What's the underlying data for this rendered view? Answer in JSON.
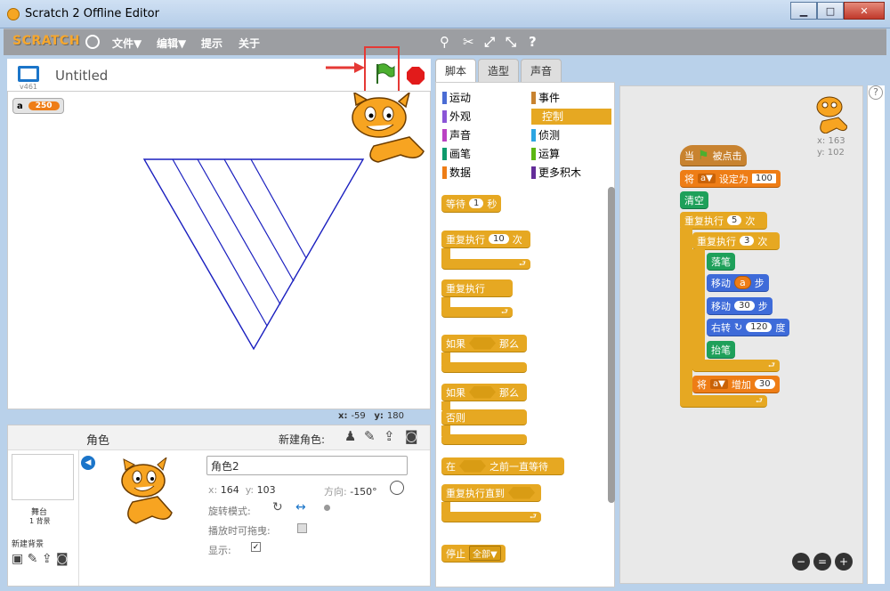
{
  "window": {
    "title": "Scratch 2 Offline Editor",
    "minimize": "▁",
    "maximize": "□",
    "close": "✕"
  },
  "menubar": {
    "logo": "SCRATCH",
    "items": [
      "文件▼",
      "编辑▼",
      "提示",
      "关于"
    ]
  },
  "stage": {
    "version": "v461",
    "project_title": "Untitled",
    "variable": {
      "name": "a",
      "value": "250"
    },
    "mouse": {
      "x_label": "x:",
      "x": "-59",
      "y_label": "y:",
      "y": "180"
    }
  },
  "sprites": {
    "header_title": "角色",
    "new_sprite_label": "新建角色:",
    "stage_label": "舞台",
    "stage_backdrops": "1 背景",
    "new_backdrop": "新建背景",
    "sprite_name": "角色2",
    "x_label": "x:",
    "x": "164",
    "y_label": "y:",
    "y": "103",
    "direction_label": "方向:",
    "direction": "-150°",
    "rotation_label": "旋转模式:",
    "drag_label": "播放时可拖曳:",
    "show_label": "显示:"
  },
  "tabs": [
    "脚本",
    "造型",
    "声音"
  ],
  "categories": [
    {
      "label": "运动",
      "color": "#4a6cd4"
    },
    {
      "label": "事件",
      "color": "#c88330"
    },
    {
      "label": "外观",
      "color": "#8a55d7"
    },
    {
      "label": "控制",
      "color": "#e6a822",
      "selected": true
    },
    {
      "label": "声音",
      "color": "#bb42c3"
    },
    {
      "label": "侦测",
      "color": "#2ca5e2"
    },
    {
      "label": "画笔",
      "color": "#0e9a6c"
    },
    {
      "label": "运算",
      "color": "#5cb712"
    },
    {
      "label": "数据",
      "color": "#ee7d16"
    },
    {
      "label": "更多积木",
      "color": "#632d99"
    }
  ],
  "palette_blocks": {
    "wait": "等待",
    "wait_num": "1",
    "wait_unit": "秒",
    "repeat": "重复执行",
    "repeat_num": "10",
    "repeat_unit": "次",
    "forever": "重复执行",
    "if": "如果",
    "then": "那么",
    "if2": "如果",
    "then2": "那么",
    "else": "否则",
    "wait_until_pre": "在",
    "wait_until_post": "之前一直等待",
    "repeat_until": "重复执行直到",
    "stop": "停止",
    "stop_option": "全部▼"
  },
  "script": {
    "when": "当",
    "clicked": "被点击",
    "set": "将",
    "set_var": "a▼",
    "set_to": "设定为",
    "set_value": "100",
    "clear": "清空",
    "outer_repeat": "重复执行",
    "outer_num": "5",
    "outer_unit": "次",
    "inner_repeat": "重复执行",
    "inner_num": "3",
    "inner_unit": "次",
    "pen_down": "落笔",
    "move1": "移动",
    "move1_var": "a",
    "move1_unit": "步",
    "move2": "移动",
    "move2_num": "30",
    "move2_unit": "步",
    "turn": "右转",
    "turn_num": "120",
    "turn_unit": "度",
    "pen_up": "抬笔",
    "change": "将",
    "change_var": "a▼",
    "change_by": "增加",
    "change_value": "30"
  },
  "script_sprite": {
    "x_label": "x:",
    "x": "163",
    "y_label": "y:",
    "y": "102"
  },
  "zoom": [
    "−",
    "=",
    "+"
  ],
  "help": "?"
}
